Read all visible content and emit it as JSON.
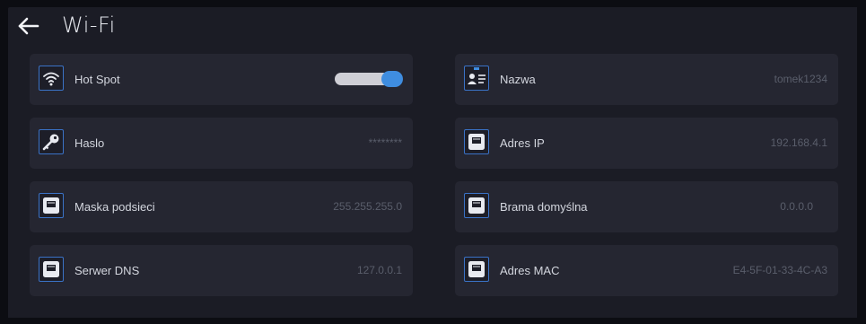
{
  "header": {
    "title": "Wi-Fi"
  },
  "settings": {
    "hotspot": {
      "label": "Hot Spot",
      "enabled": true,
      "icon": "wifi-icon"
    },
    "nazwa": {
      "label": "Nazwa",
      "value": "tomek1234",
      "icon": "id-card-icon"
    },
    "haslo": {
      "label": "Haslo",
      "value": "********",
      "icon": "key-icon"
    },
    "adres_ip": {
      "label": "Adres IP",
      "value": "192.168.4.1",
      "icon": "ethernet-port-icon"
    },
    "maska": {
      "label": "Maska podsieci",
      "value": "255.255.255.0",
      "icon": "ethernet-port-icon"
    },
    "brama": {
      "label": "Brama domyślna",
      "value": "0.0.0.0",
      "icon": "ethernet-port-icon"
    },
    "dns": {
      "label": "Serwer DNS",
      "value": "127.0.0.1",
      "icon": "ethernet-port-icon"
    },
    "mac": {
      "label": "Adres MAC",
      "value": "E4-5F-01-33-4C-A3",
      "icon": "ethernet-port-icon"
    }
  },
  "colors": {
    "background": "#1b1c25",
    "card": "#252631",
    "accent": "#3f8de0",
    "icon_border": "#3a72c6",
    "label": "#d3d6de",
    "value": "#5a5e6b"
  }
}
